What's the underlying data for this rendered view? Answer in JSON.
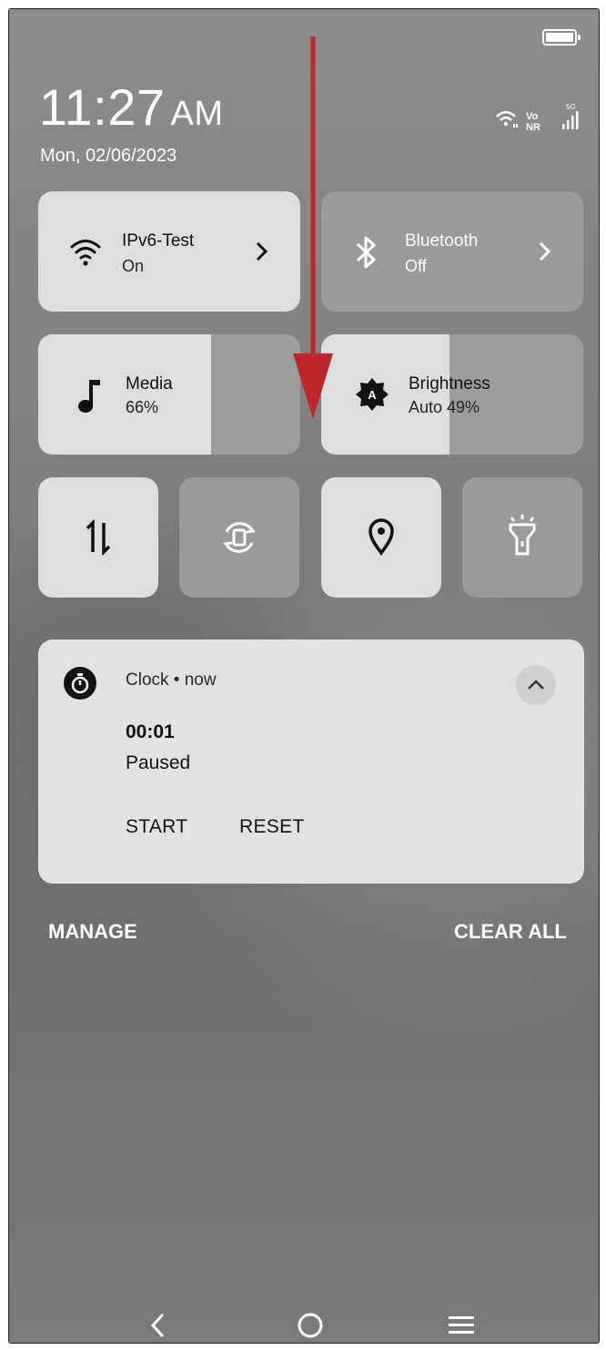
{
  "status_bar": {
    "icons": [
      "battery-icon",
      "wifi-icon",
      "vonr-icon",
      "signal-5g-icon"
    ],
    "vonr_top": "Vo",
    "vonr_bottom": "NR",
    "net": "5G"
  },
  "clock": {
    "time": "11:27",
    "ampm": "AM",
    "date": "Mon, 02/06/2023"
  },
  "tiles": {
    "wifi": {
      "title": "IPv6-Test",
      "status": "On",
      "icon": "wifi-icon"
    },
    "bluetooth": {
      "title": "Bluetooth",
      "status": "Off",
      "icon": "bluetooth-icon"
    },
    "media": {
      "title": "Media",
      "value_text": "66%",
      "level": 0.66,
      "icon": "music-note-icon"
    },
    "brightness": {
      "title": "Brightness",
      "value_text": "Auto 49%",
      "level": 0.49,
      "icon": "brightness-auto-icon",
      "badge": "A"
    },
    "toggles": [
      {
        "name": "mobile-data",
        "icon": "data-transfer-icon",
        "active": true
      },
      {
        "name": "auto-rotate",
        "icon": "auto-rotate-icon",
        "active": false
      },
      {
        "name": "location",
        "icon": "location-pin-icon",
        "active": true
      },
      {
        "name": "flashlight",
        "icon": "flashlight-icon",
        "active": false
      }
    ]
  },
  "notification": {
    "app": "Clock • now",
    "icon": "stopwatch-icon",
    "timer": "00:01",
    "state": "Paused",
    "actions": {
      "start": "START",
      "reset": "RESET"
    }
  },
  "footer": {
    "manage": "MANAGE",
    "clear_all": "CLEAR ALL"
  },
  "navigation": [
    "back-icon",
    "home-icon",
    "menu-icon"
  ],
  "colors": {
    "annotation_arrow": "#c0262d",
    "panel_bg": "#7d7d7d",
    "tile_light": "#dedede",
    "tile_dark": "#9a9a9a"
  }
}
